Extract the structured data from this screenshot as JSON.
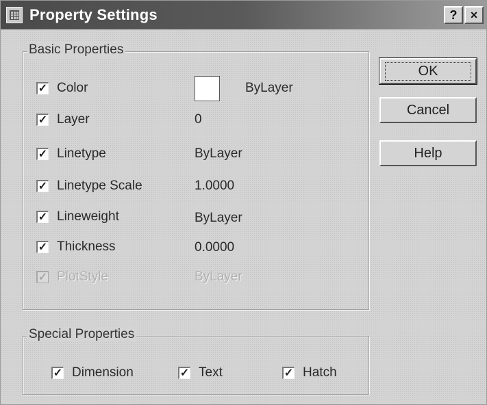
{
  "window": {
    "title": "Property Settings",
    "help_glyph": "?",
    "close_glyph": "×",
    "icon": "properties-grid-icon"
  },
  "basic": {
    "legend": "Basic Properties",
    "rows": [
      {
        "label": "Color",
        "value": "ByLayer",
        "checked": true,
        "enabled": true
      },
      {
        "label": "Layer",
        "value": "0",
        "checked": true,
        "enabled": true
      },
      {
        "label": "Linetype",
        "value": "ByLayer",
        "checked": true,
        "enabled": true
      },
      {
        "label": "Linetype Scale",
        "value": "1.0000",
        "checked": true,
        "enabled": true
      },
      {
        "label": "Lineweight",
        "value": "ByLayer",
        "checked": true,
        "enabled": true
      },
      {
        "label": "Thickness",
        "value": "0.0000",
        "checked": true,
        "enabled": true
      },
      {
        "label": "PlotStyle",
        "value": "ByLayer",
        "checked": true,
        "enabled": false
      }
    ],
    "color_swatch": "#ffffff"
  },
  "special": {
    "legend": "Special Properties",
    "items": [
      {
        "label": "Dimension",
        "checked": true
      },
      {
        "label": "Text",
        "checked": true
      },
      {
        "label": "Hatch",
        "checked": true
      }
    ]
  },
  "buttons": {
    "ok": "OK",
    "cancel": "Cancel",
    "help": "Help"
  },
  "check_glyph": "✓"
}
